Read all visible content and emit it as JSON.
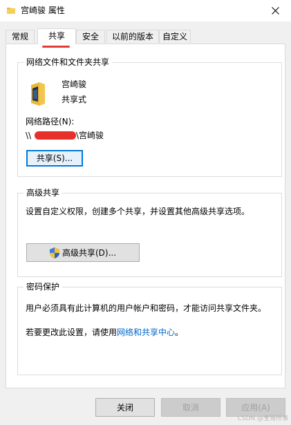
{
  "window": {
    "title": "宫崎骏 属性",
    "close_icon": "close-icon"
  },
  "tabs": [
    {
      "label": "常规"
    },
    {
      "label": "共享",
      "active": true
    },
    {
      "label": "安全"
    },
    {
      "label": "以前的版本"
    },
    {
      "label": "自定义"
    }
  ],
  "network_share": {
    "group_title": "网络文件和文件夹共享",
    "folder_name": "宫崎骏",
    "status": "共享式",
    "path_label": "网络路径(N):",
    "path_prefix": "\\\\",
    "path_suffix": "\\宫崎骏",
    "share_button": "共享(S)..."
  },
  "advanced_share": {
    "group_title": "高级共享",
    "description": "设置自定义权限，创建多个共享，并设置其他高级共享选项。",
    "button": "高级共享(D)..."
  },
  "password": {
    "group_title": "密码保护",
    "description": "用户必须具有此计算机的用户帐户和密码，才能访问共享文件夹。",
    "change_prefix": "若要更改此设置，请使用",
    "change_link": "网络和共享中心",
    "change_suffix": "。"
  },
  "footer": {
    "close": "关闭",
    "cancel": "取消",
    "apply": "应用(A)"
  },
  "watermark": "CSDN @宝哥所事"
}
